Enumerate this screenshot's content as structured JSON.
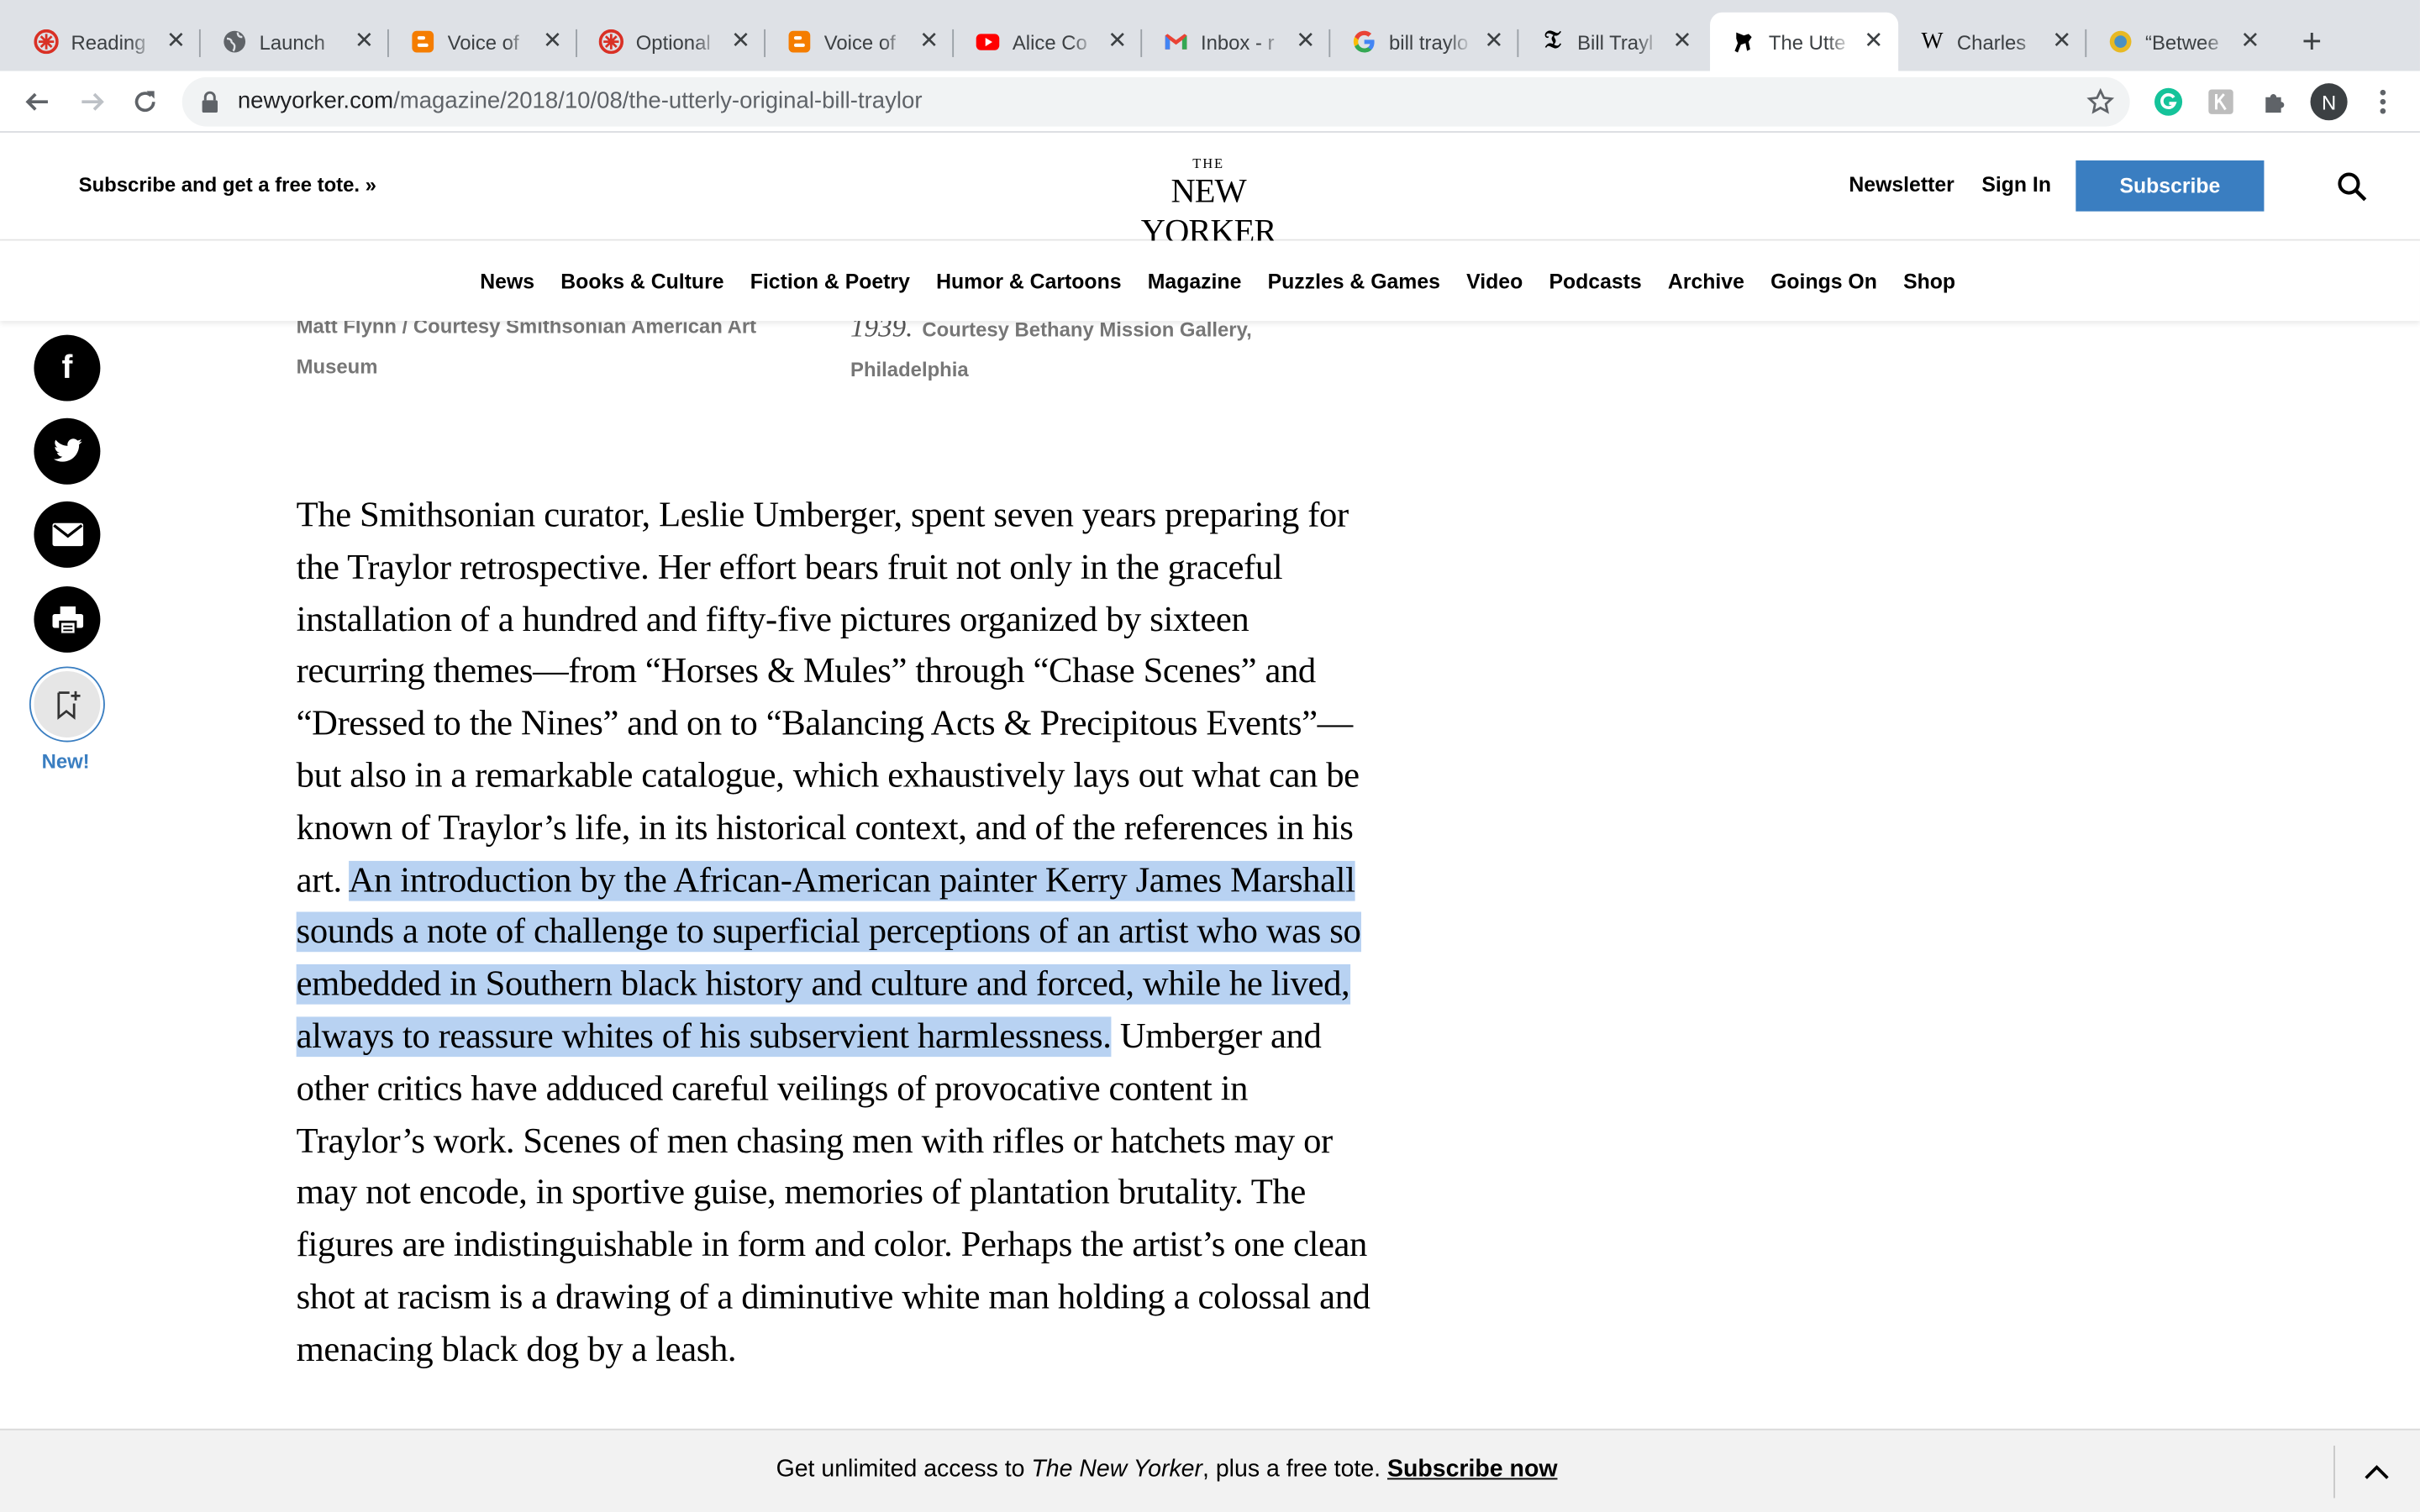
{
  "browser": {
    "tabs": [
      {
        "title": "Reading",
        "icon": "asterisk-red-icon"
      },
      {
        "title": "Launch",
        "icon": "globe-icon"
      },
      {
        "title": "Voice of",
        "icon": "blogger-icon"
      },
      {
        "title": "Optional",
        "icon": "asterisk-red-icon"
      },
      {
        "title": "Voice of",
        "icon": "blogger-icon"
      },
      {
        "title": "Alice Co",
        "icon": "youtube-icon"
      },
      {
        "title": "Inbox - r",
        "icon": "gmail-icon"
      },
      {
        "title": "bill traylo",
        "icon": "google-icon"
      },
      {
        "title": "Bill Trayl",
        "icon": "nyt-icon"
      },
      {
        "title": "The Utte",
        "icon": "new-yorker-icon",
        "active": true
      },
      {
        "title": "Charles",
        "icon": "wikipedia-icon"
      },
      {
        "title": "“Betwee",
        "icon": "sun-icon"
      }
    ],
    "url_domain": "newyorker.com",
    "url_path": "/magazine/2018/10/08/the-utterly-original-bill-traylor",
    "profile_initial": "N",
    "colors": {
      "tabstrip": "#dee1e6",
      "omnibox": "#f1f3f4",
      "grammarly": "#15c39a"
    }
  },
  "header": {
    "promo": "Subscribe and get a free tote. »",
    "logo_the": "THE",
    "logo_name": "NEW YORKER",
    "newsletter": "Newsletter",
    "sign_in": "Sign In",
    "subscribe": "Subscribe",
    "accent": "#3a7ec1"
  },
  "nav": [
    "News",
    "Books & Culture",
    "Fiction & Poetry",
    "Humor & Cartoons",
    "Magazine",
    "Puzzles & Games",
    "Video",
    "Podcasts",
    "Archive",
    "Goings On",
    "Shop"
  ],
  "captions": {
    "left_line1": "Matt Flynn / Courtesy Smithsonian American Art",
    "left_line2": "Museum",
    "right_year": "1939.",
    "right_line1": "Courtesy Bethany Mission Gallery,",
    "right_line2": "Philadelphia"
  },
  "share": {
    "new_label": "New!"
  },
  "article": {
    "before": "The Smithsonian curator, Leslie Umberger, spent seven years preparing for the Traylor retrospective. Her effort bears fruit not only in the graceful installation of a hundred and fifty-five pictures organized by sixteen recurring themes—from “Horses & Mules” through “Chase Scenes” and “Dressed to the Nines” and on to “Balancing Acts & Precipitous Events”—but also in a remarkable catalogue, which exhaustively lays out what can be known of Traylor’s life, in its historical context, and of the references in his art.",
    "highlighted": "An introduction by the African-American painter Kerry James Marshall sounds a note of challenge to superficial perceptions of an artist who was so embedded in Southern black history and culture and forced, while he lived, always to reassure whites of his subservient harmlessness.",
    "after": "Umberger and other critics have adduced careful veilings of provocative content in Traylor’s work. Scenes of men chasing men with rifles or hatchets may or may not encode, in sportive guise, memories of plantation brutality. The figures are indistinguishable in form and color. Perhaps the artist’s one clean shot at racism is a drawing of a diminutive white man holding a colossal and menacing black dog by a leash.",
    "highlight_color": "#b8d2f2"
  },
  "paywall": {
    "lead": "Get unlimited access to ",
    "publication": "The New Yorker",
    "mid": ", plus a free tote. ",
    "cta": "Subscribe now"
  }
}
